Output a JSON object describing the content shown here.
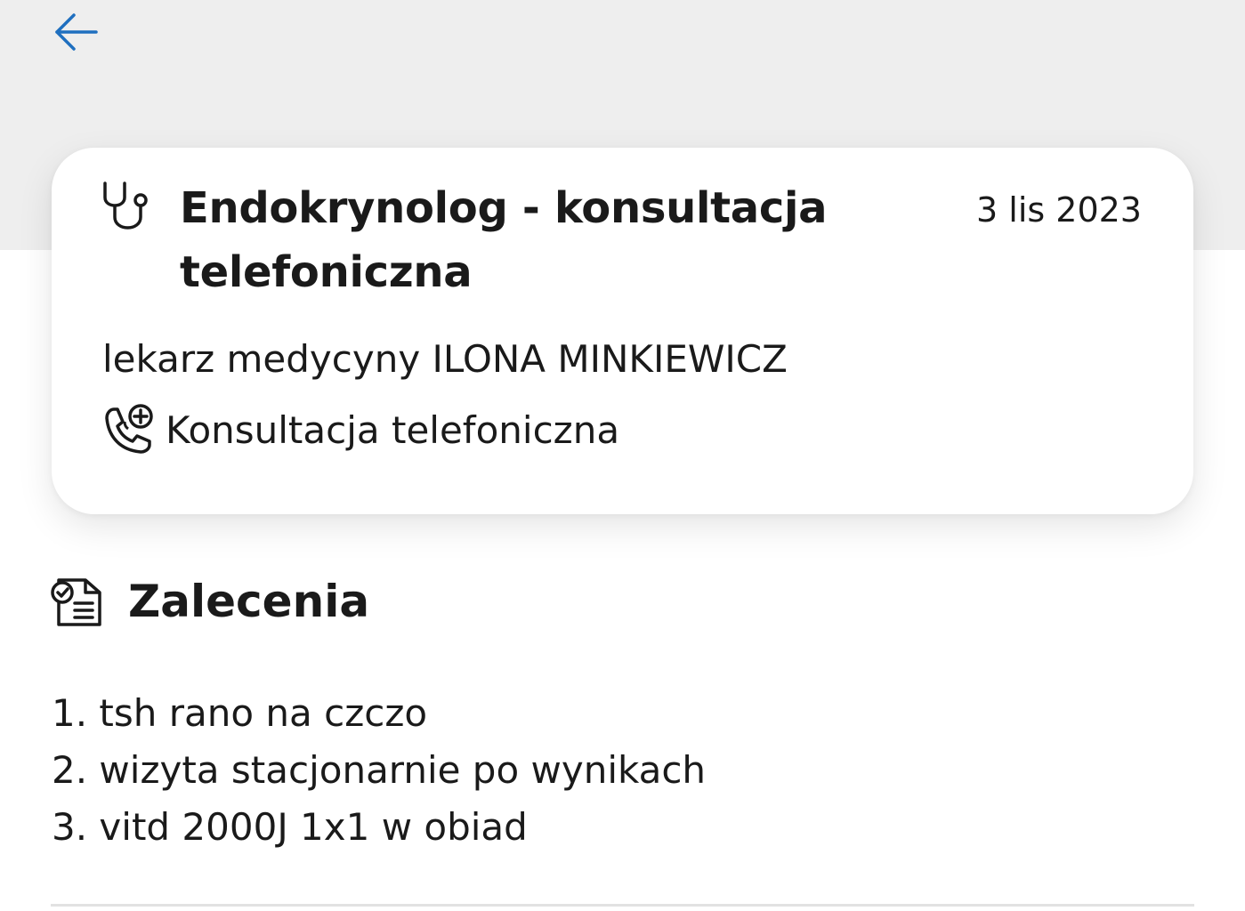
{
  "colors": {
    "accent": "#1f6fbf",
    "header_background": "#eeeeee",
    "text": "#1a1a1a"
  },
  "header": {
    "back_icon": "arrow-left-icon"
  },
  "visit": {
    "title": "Endokrynolog - konsultacja telefoniczna",
    "date": "3 lis 2023",
    "doctor": "lekarz medycyny ILONA MINKIEWICZ",
    "type_label": "Konsultacja telefoniczna",
    "title_icon": "stethoscope-icon",
    "type_icon": "phone-plus-icon"
  },
  "recommendations": {
    "title": "Zalecenia",
    "icon": "document-check-icon",
    "items": [
      "1. tsh rano na czczo",
      "2. wizyta stacjonarnie po wynikach",
      "3. vitd 2000J 1x1 w obiad"
    ]
  }
}
